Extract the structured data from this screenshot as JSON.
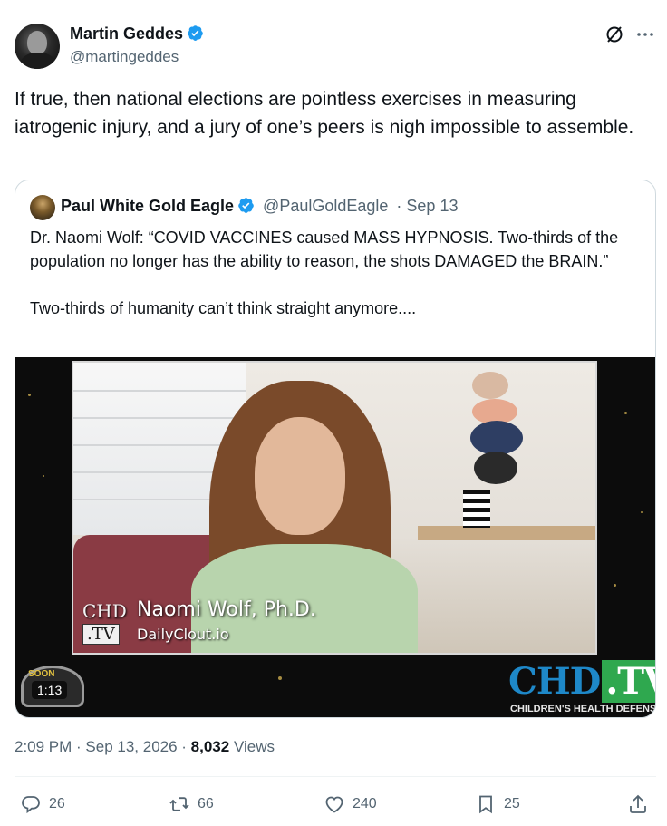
{
  "author": {
    "name": "Martin Geddes",
    "handle": "@martingeddes"
  },
  "tweet_text": "If true, then national elections are pointless exercises in measuring iatrogenic injury, and a jury of one’s peers is nigh impossible to assemble.",
  "quoted": {
    "name": "Paul White Gold Eagle",
    "handle": "@PaulGoldEagle",
    "date": "· Sep 13",
    "text": "Dr. Naomi Wolf: “COVID VACCINES caused MASS HYPNOSIS. Two-thirds of the population no longer has the ability to reason, the shots DAMAGED the BRAIN.”\n\nTwo-thirds of humanity can’t think straight anymore....",
    "video": {
      "lower_third_chd": "CHD",
      "lower_third_tv": ".TV",
      "lower_third_name": "Naomi Wolf, Ph.D.",
      "lower_third_site": "DailyClout.io",
      "badge_text": "SOON",
      "duration": "1:13",
      "logo_chd": "CHD",
      "logo_tv": ".TV",
      "logo_subtitle": "CHILDREN'S HEALTH DEFENSE"
    }
  },
  "meta": {
    "time": "2:09 PM · Sep 13, 2026 · ",
    "views_count": "8,032",
    "views_label": " Views"
  },
  "actions": {
    "replies": "26",
    "reposts": "66",
    "likes": "240",
    "bookmarks": "25"
  },
  "colors": {
    "verified": "#1d9bf0",
    "text_primary": "#0f1419",
    "text_secondary": "#536471",
    "border": "#cfd9de"
  },
  "icons": [
    "verified-badge-icon",
    "grok-icon",
    "more-icon",
    "reply-icon",
    "repost-icon",
    "like-icon",
    "bookmark-icon",
    "share-icon"
  ]
}
